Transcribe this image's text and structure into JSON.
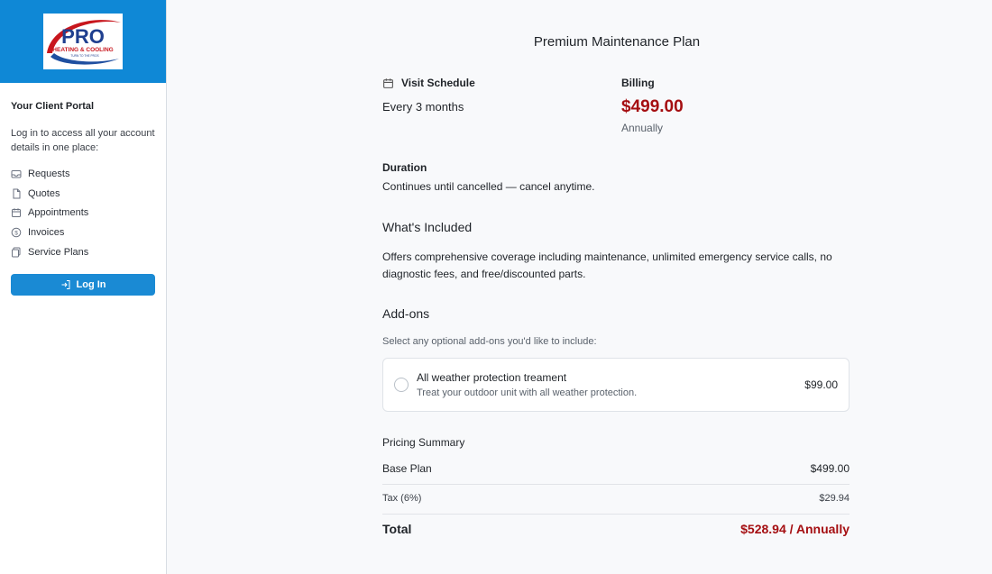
{
  "sidebar": {
    "logo_text": "PRO",
    "logo_sub": "HEATING & COOLING",
    "logo_tag": "TURN TO THE PROS",
    "portal_title": "Your Client Portal",
    "portal_desc": "Log in to access all your account details in one place:",
    "nav": [
      {
        "label": "Requests",
        "icon": "inbox-icon"
      },
      {
        "label": "Quotes",
        "icon": "document-icon"
      },
      {
        "label": "Appointments",
        "icon": "calendar-icon"
      },
      {
        "label": "Invoices",
        "icon": "dollar-circle-icon"
      },
      {
        "label": "Service Plans",
        "icon": "service-plan-icon"
      }
    ],
    "login_label": "Log In"
  },
  "plan": {
    "title": "Premium Maintenance Plan",
    "visit_label": "Visit Schedule",
    "visit_value": "Every 3 months",
    "billing_label": "Billing",
    "price": "$499.00",
    "period": "Annually",
    "duration_label": "Duration",
    "duration_value": "Continues until cancelled — cancel anytime.",
    "included_title": "What's Included",
    "included_text": "Offers comprehensive coverage including maintenance, unlimited emergency service calls, no diagnostic fees, and free/discounted parts."
  },
  "addons": {
    "title": "Add-ons",
    "subtitle": "Select any optional add-ons you'd like to include:",
    "items": [
      {
        "name": "All weather protection treament",
        "desc": "Treat your outdoor unit with all weather protection.",
        "price": "$99.00",
        "selected": false
      }
    ]
  },
  "summary": {
    "title": "Pricing Summary",
    "base_label": "Base Plan",
    "base_value": "$499.00",
    "tax_label": "Tax (6%)",
    "tax_value": "$29.94",
    "total_label": "Total",
    "total_value": "$528.94 / Annually"
  },
  "colors": {
    "brand_blue": "#0f88d6",
    "accent_red": "#a50f12",
    "button_blue": "#1a8ad4"
  }
}
